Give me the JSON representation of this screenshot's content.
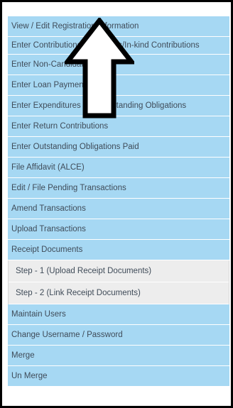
{
  "menu": {
    "items": [
      {
        "label": "View / Edit Registration Information"
      },
      {
        "label": "Enter Contributions / Transfers/In-kind Contributions"
      },
      {
        "label": "Enter Non-Candidate Loans"
      },
      {
        "label": "Enter Loan Payments"
      },
      {
        "label": "Enter Expenditures and Outstanding Obligations"
      },
      {
        "label": "Enter Return Contributions"
      },
      {
        "label": "Enter Outstanding Obligations Paid"
      },
      {
        "label": "File Affidavit (ALCE)"
      },
      {
        "label": "Edit / File Pending Transactions"
      },
      {
        "label": "Amend Transactions"
      },
      {
        "label": "Upload Transactions"
      },
      {
        "label": "Receipt Documents"
      }
    ],
    "sub_items": [
      {
        "label": "Step - 1 (Upload Receipt Documents)"
      },
      {
        "label": "Step - 2 (Link Receipt Documents)"
      }
    ],
    "items_after": [
      {
        "label": "Maintain Users"
      },
      {
        "label": "Change Username / Password"
      },
      {
        "label": "Merge"
      },
      {
        "label": "Un Merge"
      }
    ]
  },
  "annotation": {
    "icon": "up-arrow-outline-icon",
    "color": "#000000"
  },
  "colors": {
    "item_bg": "#a6d8f3",
    "sub_bg": "#ededed",
    "text": "#3f4b58",
    "border": "#000000"
  }
}
